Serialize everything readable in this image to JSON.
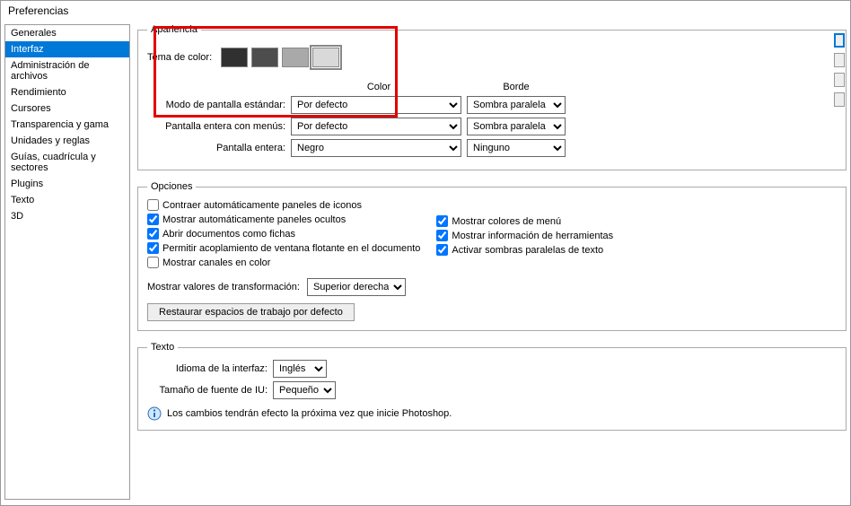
{
  "titlebar": "Preferencias",
  "sidebar": {
    "items": [
      {
        "label": "Generales"
      },
      {
        "label": "Interfaz"
      },
      {
        "label": "Administración de archivos"
      },
      {
        "label": "Rendimiento"
      },
      {
        "label": "Cursores"
      },
      {
        "label": "Transparencia y gama"
      },
      {
        "label": "Unidades y reglas"
      },
      {
        "label": "Guías, cuadrícula y sectores"
      },
      {
        "label": "Plugins"
      },
      {
        "label": "Texto"
      },
      {
        "label": "3D"
      }
    ],
    "selected_index": 1
  },
  "apariencia": {
    "title": "Apariencia",
    "tema_label": "Tema de color:",
    "swatches": [
      "#303030",
      "#4d4d4d",
      "#a9a9a9",
      "#d9d9d9"
    ],
    "swatch_selected": 3,
    "hdr_color": "Color",
    "hdr_border": "Borde",
    "rows": [
      {
        "label": "Modo de pantalla estándar:",
        "color": "Por defecto",
        "border": "Sombra paralela"
      },
      {
        "label": "Pantalla entera con menús:",
        "color": "Por defecto",
        "border": "Sombra paralela"
      },
      {
        "label": "Pantalla entera:",
        "color": "Negro",
        "border": "Ninguno"
      }
    ]
  },
  "opciones": {
    "title": "Opciones",
    "left": [
      {
        "label": "Contraer automáticamente paneles de iconos",
        "checked": false
      },
      {
        "label": "Mostrar automáticamente paneles ocultos",
        "checked": true
      },
      {
        "label": "Abrir documentos como fichas",
        "checked": true
      },
      {
        "label": "Permitir acoplamiento de ventana flotante en el documento",
        "checked": true
      },
      {
        "label": "Mostrar canales en color",
        "checked": false
      }
    ],
    "right": [
      {
        "label": "Mostrar colores de menú",
        "checked": true
      },
      {
        "label": "Mostrar información de herramientas",
        "checked": true
      },
      {
        "label": "Activar sombras paralelas de texto",
        "checked": true
      }
    ],
    "transform_label": "Mostrar valores de transformación:",
    "transform_value": "Superior derecha",
    "restore_btn": "Restaurar espacios de trabajo por defecto"
  },
  "texto": {
    "title": "Texto",
    "lang_label": "Idioma de la interfaz:",
    "lang_value": "Inglés",
    "font_label": "Tamaño de fuente de IU:",
    "font_value": "Pequeño",
    "info": "Los cambios tendrán efecto la próxima vez que inicie Photoshop."
  }
}
